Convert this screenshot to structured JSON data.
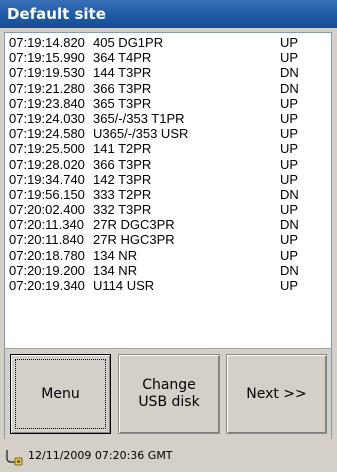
{
  "window": {
    "title": "Default site"
  },
  "log": [
    {
      "time": "07:19:14.820",
      "code": "405 DG1PR",
      "status": "UP"
    },
    {
      "time": "07:19:15.990",
      "code": "364 T4PR",
      "status": "UP"
    },
    {
      "time": "07:19:19.530",
      "code": "144 T3PR",
      "status": "DN"
    },
    {
      "time": "07:19:21.280",
      "code": "366 T3PR",
      "status": "DN"
    },
    {
      "time": "07:19:23.840",
      "code": "365 T3PR",
      "status": "UP"
    },
    {
      "time": "07:19:24.030",
      "code": "365/-/353 T1PR",
      "status": "UP"
    },
    {
      "time": "07:19:24.580",
      "code": "U365/-/353 USR",
      "status": "UP"
    },
    {
      "time": "07:19:25.500",
      "code": "141 T2PR",
      "status": "UP"
    },
    {
      "time": "07:19:28.020",
      "code": "366 T3PR",
      "status": "UP"
    },
    {
      "time": "07:19:34.740",
      "code": "142 T3PR",
      "status": "UP"
    },
    {
      "time": "07:19:56.150",
      "code": "333 T2PR",
      "status": "DN"
    },
    {
      "time": "07:20:02.400",
      "code": "332 T3PR",
      "status": "UP"
    },
    {
      "time": "07:20:11.340",
      "code": "27R DGC3PR",
      "status": "DN"
    },
    {
      "time": "07:20:11.840",
      "code": "27R HGC3PR",
      "status": "UP"
    },
    {
      "time": "07:20:18.780",
      "code": "134 NR",
      "status": "UP"
    },
    {
      "time": "07:20:19.200",
      "code": "134 NR",
      "status": "DN"
    },
    {
      "time": "07:20:19.340",
      "code": "U114 USR",
      "status": "UP"
    }
  ],
  "buttons": {
    "menu": "Menu",
    "change_usb": "Change USB disk",
    "next": "Next >>"
  },
  "status": {
    "icon": "usb-plug-icon",
    "text": "12/11/2009  07:20:36 GMT"
  }
}
